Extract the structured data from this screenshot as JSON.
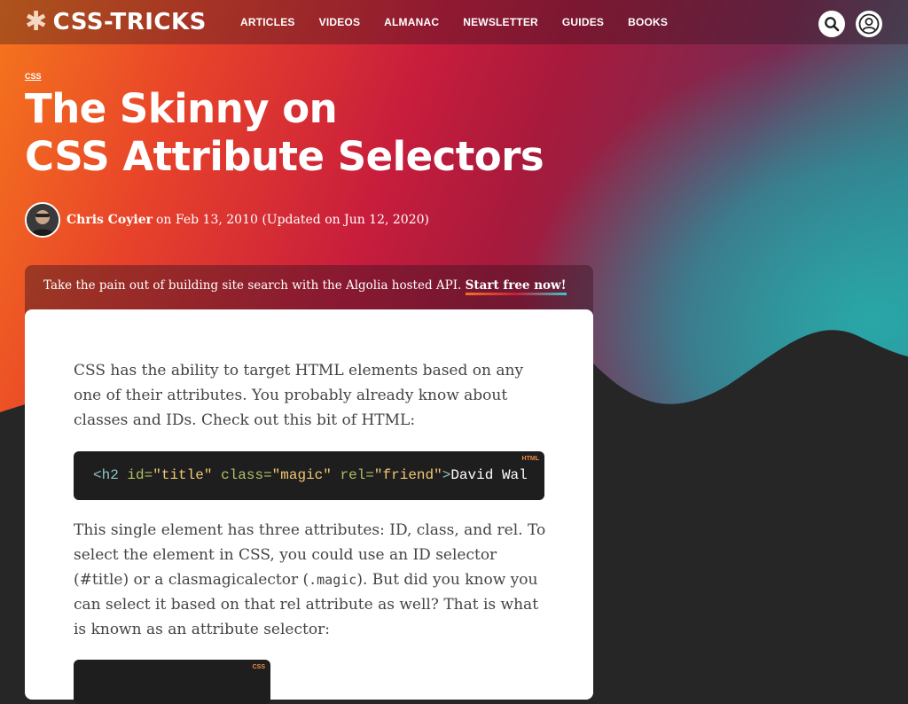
{
  "site": {
    "logo_text": "CSS-TRICKS",
    "logo_icon": "asterisk-icon"
  },
  "nav": {
    "items": [
      {
        "label": "ARTICLES"
      },
      {
        "label": "VIDEOS"
      },
      {
        "label": "ALMANAC"
      },
      {
        "label": "NEWSLETTER"
      },
      {
        "label": "GUIDES"
      },
      {
        "label": "BOOKS"
      }
    ],
    "search_icon": "search-icon",
    "account_icon": "user-icon"
  },
  "article": {
    "category": "CSS",
    "title_line1": "The Skinny on",
    "title_line2": "CSS Attribute Selectors",
    "author": "Chris Coyier",
    "date_text": "on Feb 13, 2010 (Updated on Jun 12, 2020)"
  },
  "ad": {
    "text": "Take the pain out of building site search with the Algolia hosted API.",
    "link": "Start free now!"
  },
  "content": {
    "para1": "CSS has the ability to target HTML elements based on any one of their attributes. You probably already know about classes and IDs. Check out this bit of HTML:",
    "code1": {
      "lang": "HTML",
      "tag_open": "<h2",
      "attr1": "id=",
      "val1": "\"title\"",
      "attr2": "class=",
      "val2": "\"magic\"",
      "attr3": "rel=",
      "val3": "\"friend\"",
      "close": ">",
      "text": "David Wal"
    },
    "para2_a": "This single element has three attributes: ID, class, and rel. To select the element in CSS, you could use an ID selector (#title) or a clasmagicalector (",
    "para2_code": ".magic",
    "para2_b": "). But did you know you can select it based on that rel attribute as well? That is what is known as an attribute selector:",
    "code2": {
      "lang": "CSS"
    }
  },
  "colors": {
    "accent_orange": "#f5761c",
    "accent_red": "#c81d3c",
    "accent_teal": "#2ea5a5",
    "dark_bg": "#262626"
  }
}
